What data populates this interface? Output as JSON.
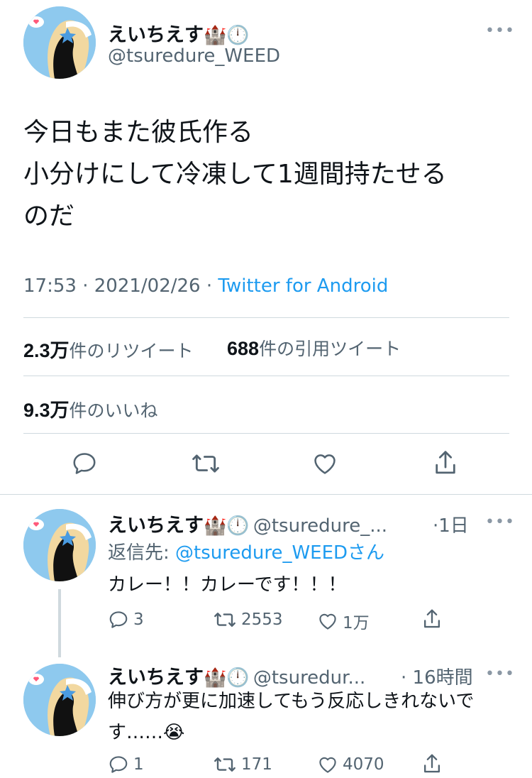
{
  "main_tweet": {
    "display_name": "えいちえす",
    "name_emoji": "🏰",
    "name_emoji2": "🕛",
    "handle": "@tsuredure_WEED",
    "text_lines": [
      "今日もまた彼氏作る",
      "小分けにして冷凍して1週間持たせる",
      "のだ"
    ],
    "time": "17:53",
    "date": "2021/02/26",
    "separator": "·",
    "source": "Twitter for Android",
    "retweets_value": "2.3万",
    "retweets_label": "件のリツイート",
    "quotes_value": "688",
    "quotes_label": "件の引用ツイート",
    "likes_value": "9.3万",
    "likes_label": "件のいいね",
    "more": "•••"
  },
  "replies": [
    {
      "display_name": "えいちえす",
      "name_emoji": "🏰",
      "name_emoji2": "🕛",
      "handle": "@tsuredure_...",
      "time": "·1日",
      "replying_prefix": "返信先: ",
      "replying_handle": "@tsuredure_WEED",
      "replying_suffix": "さん",
      "text": "カレー！！カレーです！！！",
      "reply_count": "3",
      "retweet_count": "2553",
      "like_count": "1万",
      "more": "•••"
    },
    {
      "display_name": "えいちえす",
      "name_emoji": "🏰",
      "name_emoji2": "🕛",
      "handle": "@tsuredur...",
      "time": "· 16時間",
      "text_line1": "伸び方が更に加速してもう反応しきれないで",
      "text_line2": "す……",
      "text_emoji": "😭",
      "reply_count": "1",
      "retweet_count": "171",
      "like_count": "4070",
      "more": "•••"
    }
  ],
  "colors": {
    "accent": "#1d9bf0",
    "secondary_text": "#536471",
    "avatar_bg": "#8ec9ee"
  }
}
